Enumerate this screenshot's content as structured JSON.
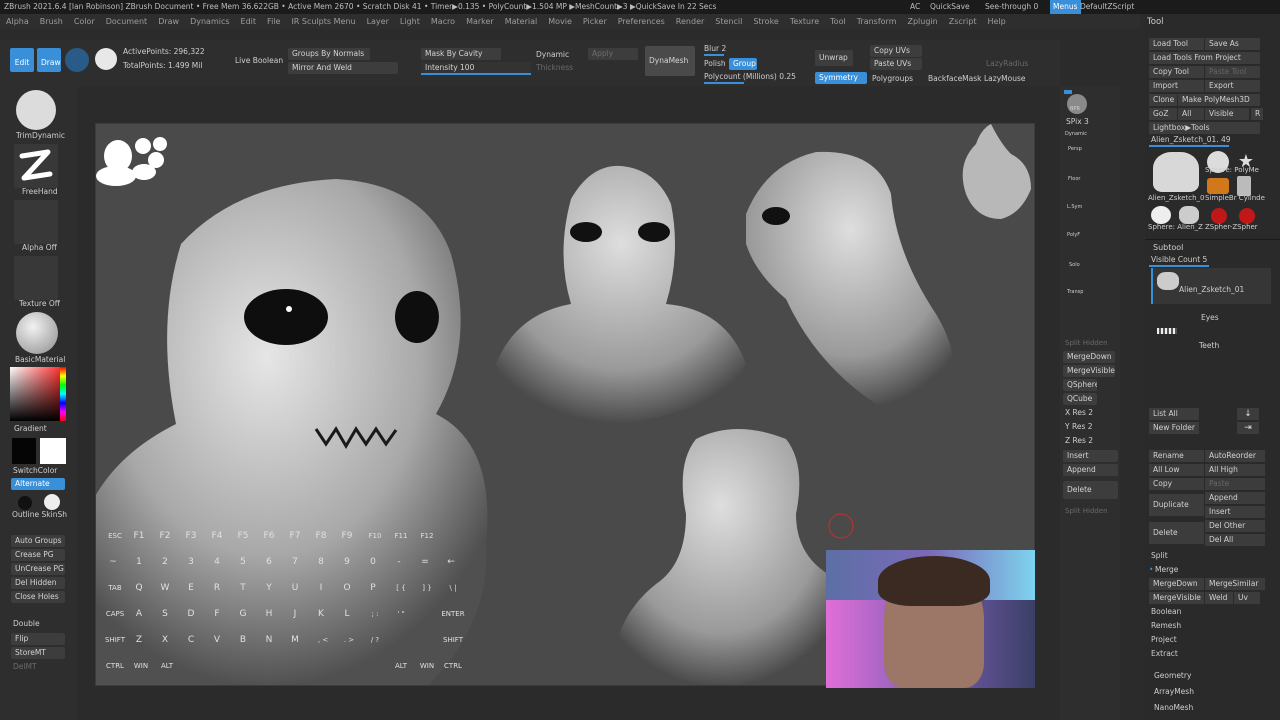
{
  "titlebar": {
    "text": "ZBrush 2021.6.4 [Ian Robinson]   ZBrush Document    • Free Mem 36.622GB • Active Mem 2670 • Scratch Disk 41 • Timer▶0.135 • PolyCount▶1.504 MP    ▶MeshCount▶3  ▶QuickSave In 22 Secs",
    "ac": "AC",
    "quicksave": "QuickSave",
    "seethrough": "See-through  0",
    "menus": "Menus",
    "script": "DefaultZScript"
  },
  "menus": [
    "Alpha",
    "Brush",
    "Color",
    "Document",
    "Draw",
    "Dynamics",
    "Edit",
    "File",
    "IR Sculpts Menu",
    "Layer",
    "Light",
    "Macro",
    "Marker",
    "Material",
    "Movie",
    "Picker",
    "Preferences",
    "Render",
    "Stencil",
    "Stroke",
    "Texture",
    "Tool",
    "Transform",
    "Zplugin",
    "Zscript",
    "Help"
  ],
  "shelf": {
    "edit": "Edit",
    "draw": "Draw",
    "active_points": "ActivePoints: 296,322",
    "total_points": "TotalPoints: 1.499 Mil",
    "live_boolean": "Live Boolean",
    "groups_by_normals": "Groups By Normals",
    "mirror_and_weld": "Mirror And Weld",
    "mask_by_cavity": "Mask By Cavity",
    "intensity": "Intensity 100",
    "dynamic": "Dynamic",
    "apply": "Apply",
    "thickness": "Thickness",
    "dynamesh": "DynaMesh",
    "blur": "Blur 2",
    "polish": "Polish",
    "group": "Group",
    "polycount": "Polycount (Millions) 0.25",
    "unwrap": "Unwrap",
    "symmetry": "Symmetry",
    "copy_uvs": "Copy UVs",
    "paste_uvs": "Paste UVs",
    "polygroups": "Polygroups",
    "backface": "BackfaceMask",
    "lazyradius": "LazyRadius",
    "lazymouse": "LazyMouse"
  },
  "left": {
    "trim": "TrimDynamic",
    "freehand": "FreeHand",
    "alpha_off": "Alpha Off",
    "texture_off": "Texture Off",
    "material": "BasicMaterial",
    "gradient": "Gradient",
    "switch_color": "SwitchColor",
    "alternate": "Alternate",
    "outline": "Outline SkinSh",
    "auto_groups": "Auto Groups",
    "crease_pg": "Crease PG",
    "uncrease_pg": "UnCrease PG",
    "del_hidden": "Del Hidden",
    "close_holes": "Close Holes",
    "double": "Double",
    "flip": "Flip",
    "storemt": "StoreMT",
    "delmt": "DelMT"
  },
  "right": {
    "bpr": "BPR",
    "spix": "SPix 3",
    "dynamic": "Dynamic",
    "persp": "Persp",
    "floor": "Floor",
    "lsym": "L.Sym",
    "polyf": "PolyF",
    "solo": "Solo",
    "transp": "Transp",
    "split_hidden": "Split Hidden",
    "merge_down": "MergeDown",
    "merge_visible": "MergeVisible",
    "qsphere": "QSphere",
    "qcube": "QCube",
    "xres": "X Res 2",
    "yres": "Y Res 2",
    "zres": "Z Res 2",
    "insert": "Insert",
    "append": "Append",
    "delete": "Delete",
    "split_hidden2": "Split Hidden"
  },
  "keyboard": {
    "row1": [
      "ESC",
      "F1",
      "F2",
      "F3",
      "F4",
      "F5",
      "F6",
      "F7",
      "F8",
      "F9",
      "F10",
      "F11",
      "F12"
    ],
    "row2": [
      "~",
      "1",
      "2",
      "3",
      "4",
      "5",
      "6",
      "7",
      "8",
      "9",
      "0",
      "-",
      "=",
      "←"
    ],
    "row3": [
      "TAB",
      "Q",
      "W",
      "E",
      "R",
      "T",
      "Y",
      "U",
      "I",
      "O",
      "P",
      "[ {",
      "] }",
      "\\ |"
    ],
    "row4": [
      "CAPS",
      "A",
      "S",
      "D",
      "F",
      "G",
      "H",
      "J",
      "K",
      "L",
      ";  :",
      "'  \"",
      "ENTER"
    ],
    "row5": [
      "SHIFT",
      "Z",
      "X",
      "C",
      "V",
      "B",
      "N",
      "M",
      ",  <",
      ".  >",
      "/  ?",
      "SHIFT"
    ],
    "row6": [
      "CTRL",
      "WIN",
      "ALT",
      "ALT",
      "WIN",
      "CTRL"
    ]
  },
  "panel": {
    "tool": "Tool",
    "load_tool": "Load Tool",
    "save_as": "Save As",
    "load_from_project": "Load Tools From Project",
    "copy_tool": "Copy Tool",
    "paste_tool": "Paste Tool",
    "import": "Import",
    "export": "Export",
    "clone": "Clone",
    "make_polymesh": "Make PolyMesh3D",
    "goz": "GoZ",
    "all": "All",
    "visible": "Visible",
    "r": "R",
    "lightbox": "Lightbox▶Tools",
    "current_tool": "Alien_Zsketch_01. 49",
    "tools": [
      "Alien_Zsketch_0",
      "Sphere: PolyMe",
      "SimpleBr Cylinde",
      "Sphere: Alien_Z",
      "ZSpher-ZSpher"
    ],
    "subtool": "Subtool",
    "visible_count": "Visible Count 5",
    "subtools": [
      "Alien_Zsketch_01",
      "Eyes",
      "Teeth"
    ],
    "list_all": "List All",
    "new_folder": "New Folder",
    "rename": "Rename",
    "autoreorder": "AutoReorder",
    "all_low": "All Low",
    "all_high": "All High",
    "copy": "Copy",
    "paste": "Paste",
    "duplicate": "Duplicate",
    "append": "Append",
    "insert": "Insert",
    "delete": "Delete",
    "del_other": "Del Other",
    "del_all": "Del All",
    "split": "Split",
    "merge": "Merge",
    "merge_down": "MergeDown",
    "merge_similar": "MergeSimilar",
    "merge_visible": "MergeVisible",
    "weld": "Weld",
    "uv": "Uv",
    "boolean": "Boolean",
    "remesh": "Remesh",
    "project": "Project",
    "extract": "Extract",
    "geometry": "Geometry",
    "arraymesh": "ArrayMesh",
    "nanomesh": "NanoMesh"
  },
  "colors": {
    "accent": "#3a8fd9",
    "bg": "#2b2b2b",
    "canvas": "#4a4a4a"
  }
}
